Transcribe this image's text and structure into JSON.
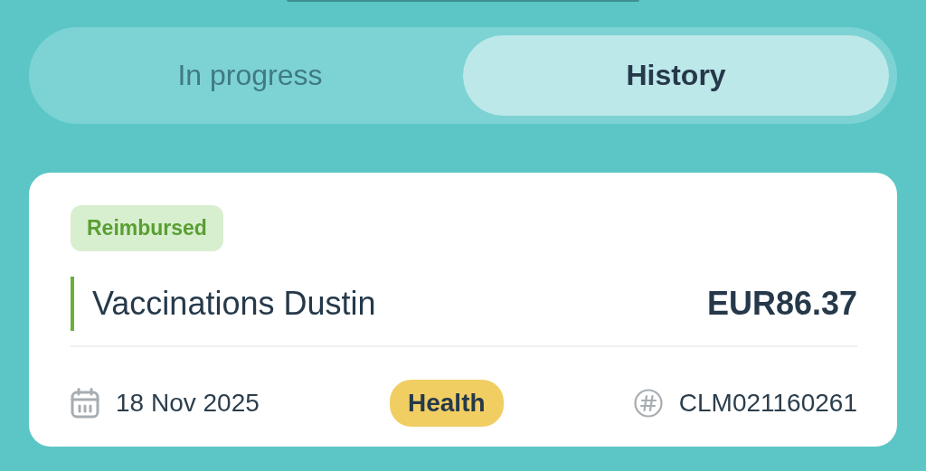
{
  "tabs": [
    {
      "label": "In progress",
      "selected": false
    },
    {
      "label": "History",
      "selected": true
    }
  ],
  "claims": [
    {
      "status": "Reimbursed",
      "title": "Vaccinations Dustin",
      "amount": "EUR86.37",
      "date": "18 Nov 2025",
      "category": "Health",
      "reference": "CLM021160261"
    }
  ]
}
